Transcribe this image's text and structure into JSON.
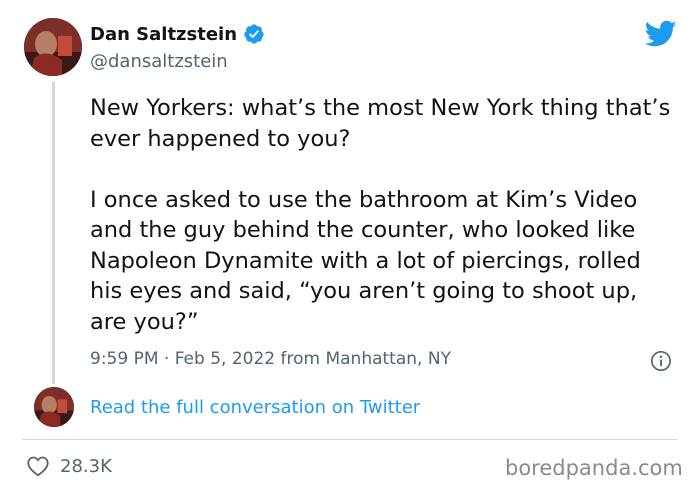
{
  "user": {
    "display_name": "Dan Saltzstein",
    "handle": "@dansaltzstein",
    "verified": true
  },
  "tweet": {
    "text": "New Yorkers: what’s the most New York thing that’s ever happened to you?\n\nI once asked to use the bathroom at Kim’s Video and the guy behind the counter, who looked like Napoleon Dynamite with a lot of piercings, rolled his eyes and said, “you aren’t going to shoot up, are you?”",
    "meta": "9:59 PM · Feb 5, 2022 from Manhattan, NY"
  },
  "conversation_link": "Read the full conversation on Twitter",
  "likes": "28.3K",
  "watermark": "boredpanda.com",
  "icons": {
    "brand": "twitter-bird-icon",
    "verified": "verified-badge-icon",
    "info": "info-icon",
    "like": "heart-icon"
  },
  "colors": {
    "twitter_blue": "#1d9bf0",
    "text": "#0f1419",
    "secondary": "#536471",
    "divider": "#cfd9de"
  }
}
